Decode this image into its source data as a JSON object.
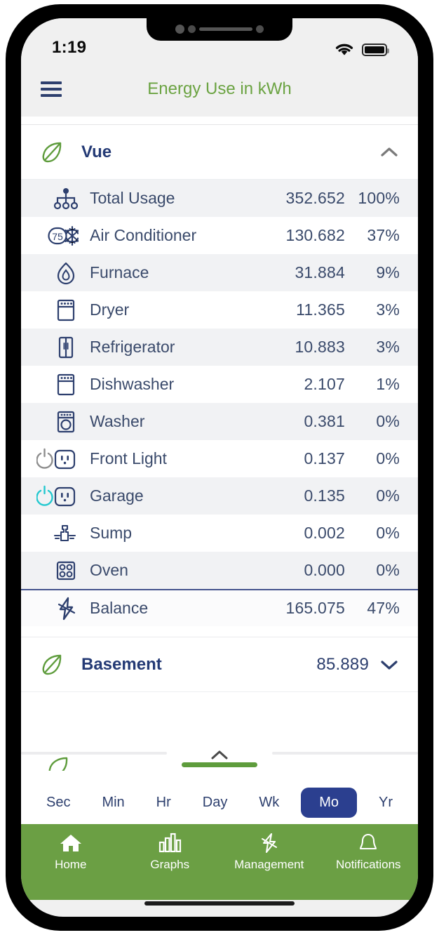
{
  "status_bar": {
    "time": "1:19",
    "wifi_icon": "wifi-icon",
    "battery_icon": "battery-full-icon"
  },
  "header": {
    "menu_icon": "hamburger-menu-icon",
    "title": "Energy Use in kWh",
    "title_color": "#6ba342"
  },
  "groups": [
    {
      "name": "Vue",
      "leaf_icon": "leaf-icon",
      "expanded": true,
      "chevron_icon": "chevron-up-icon",
      "value": "",
      "rows": [
        {
          "icon": "sitemap-icon",
          "label": "Total Usage",
          "value": "352.652",
          "pct": "100%",
          "indent": false,
          "shaded": true
        },
        {
          "icon": "thermostat-75-snowflake-icon",
          "label": "Air Conditioner",
          "value": "130.682",
          "pct": "37%",
          "indent": false,
          "shaded": false
        },
        {
          "icon": "flame-icon",
          "label": "Furnace",
          "value": "31.884",
          "pct": "9%",
          "indent": true,
          "shaded": true
        },
        {
          "icon": "dryer-icon",
          "label": "Dryer",
          "value": "11.365",
          "pct": "3%",
          "indent": true,
          "shaded": false
        },
        {
          "icon": "refrigerator-icon",
          "label": "Refrigerator",
          "value": "10.883",
          "pct": "3%",
          "indent": true,
          "shaded": true
        },
        {
          "icon": "dishwasher-icon",
          "label": "Dishwasher",
          "value": "2.107",
          "pct": "1%",
          "indent": true,
          "shaded": false
        },
        {
          "icon": "washer-icon",
          "label": "Washer",
          "value": "0.381",
          "pct": "0%",
          "indent": true,
          "shaded": true
        },
        {
          "icon": "power-off-outlet-icon",
          "label": "Front Light",
          "value": "0.137",
          "pct": "0%",
          "indent": false,
          "shaded": false
        },
        {
          "icon": "power-on-outlet-icon",
          "label": "Garage",
          "value": "0.135",
          "pct": "0%",
          "indent": false,
          "shaded": true
        },
        {
          "icon": "sump-pump-icon",
          "label": "Sump",
          "value": "0.002",
          "pct": "0%",
          "indent": true,
          "shaded": false
        },
        {
          "icon": "oven-icon",
          "label": "Oven",
          "value": "0.000",
          "pct": "0%",
          "indent": true,
          "shaded": true
        },
        {
          "icon": "bolt-icon",
          "label": "Balance",
          "value": "165.075",
          "pct": "47%",
          "indent": true,
          "shaded": false
        }
      ]
    },
    {
      "name": "Basement",
      "leaf_icon": "leaf-icon",
      "expanded": false,
      "chevron_icon": "chevron-down-icon",
      "value": "85.889",
      "rows": []
    }
  ],
  "drawer": {
    "chevron_icon": "chevron-up-icon",
    "handle": "drawer-handle"
  },
  "time_selector": {
    "options": [
      {
        "label": "Sec",
        "active": false
      },
      {
        "label": "Min",
        "active": false
      },
      {
        "label": "Hr",
        "active": false
      },
      {
        "label": "Day",
        "active": false
      },
      {
        "label": "Wk",
        "active": false
      },
      {
        "label": "Mo",
        "active": true
      },
      {
        "label": "Yr",
        "active": false
      }
    ],
    "active_color": "#2b3f8f"
  },
  "bottom_nav": {
    "background": "#6b9f44",
    "items": [
      {
        "label": "Home",
        "icon": "home-icon",
        "active": true
      },
      {
        "label": "Graphs",
        "icon": "bar-chart-icon",
        "active": false
      },
      {
        "label": "Management",
        "icon": "bolt-icon",
        "active": false
      },
      {
        "label": "Notifications",
        "icon": "bell-icon",
        "active": false
      }
    ]
  },
  "theme": {
    "green": "#6b9f44",
    "navy": "#2d3f6e",
    "row_text": "#3a4a6b",
    "power_on": "#22c8cf",
    "power_off": "#8d8d8d"
  }
}
